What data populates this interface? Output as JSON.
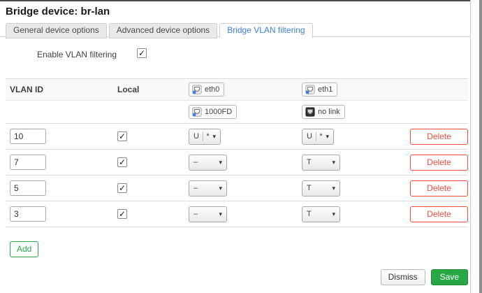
{
  "page": {
    "title": "Bridge device: br-lan"
  },
  "tabs": [
    {
      "label": "General device options",
      "active": false
    },
    {
      "label": "Advanced device options",
      "active": false
    },
    {
      "label": "Bridge VLAN filtering",
      "active": true
    }
  ],
  "options": {
    "enable_vlan_filtering": {
      "label": "Enable VLAN filtering",
      "checked": true
    }
  },
  "table": {
    "headers": {
      "vlan_id": "VLAN ID",
      "local": "Local"
    },
    "ports": [
      {
        "name": "eth0",
        "status": "1000FD",
        "link_up": true
      },
      {
        "name": "eth1",
        "status": "no link",
        "link_up": false
      }
    ],
    "rows": [
      {
        "vlan_id": "10",
        "local": true,
        "eth0": {
          "primary": "U",
          "secondary": "*"
        },
        "eth1": {
          "primary": "U",
          "secondary": "*"
        }
      },
      {
        "vlan_id": "7",
        "local": true,
        "eth0": {
          "primary": "–"
        },
        "eth1": {
          "primary": "T"
        }
      },
      {
        "vlan_id": "5",
        "local": true,
        "eth0": {
          "primary": "–"
        },
        "eth1": {
          "primary": "T"
        }
      },
      {
        "vlan_id": "3",
        "local": true,
        "eth0": {
          "primary": "–"
        },
        "eth1": {
          "primary": "T"
        }
      }
    ],
    "actions": {
      "delete_label": "Delete",
      "add_label": "Add"
    }
  },
  "footer": {
    "dismiss_label": "Dismiss",
    "save_label": "Save"
  },
  "icons": {
    "check": "✓",
    "dropdown_arrow": "▾"
  },
  "colors": {
    "accent_blue": "#3b82d6",
    "danger_red": "#f04e3e",
    "success_green": "#28a745",
    "border_gray": "#dcdcdc"
  }
}
